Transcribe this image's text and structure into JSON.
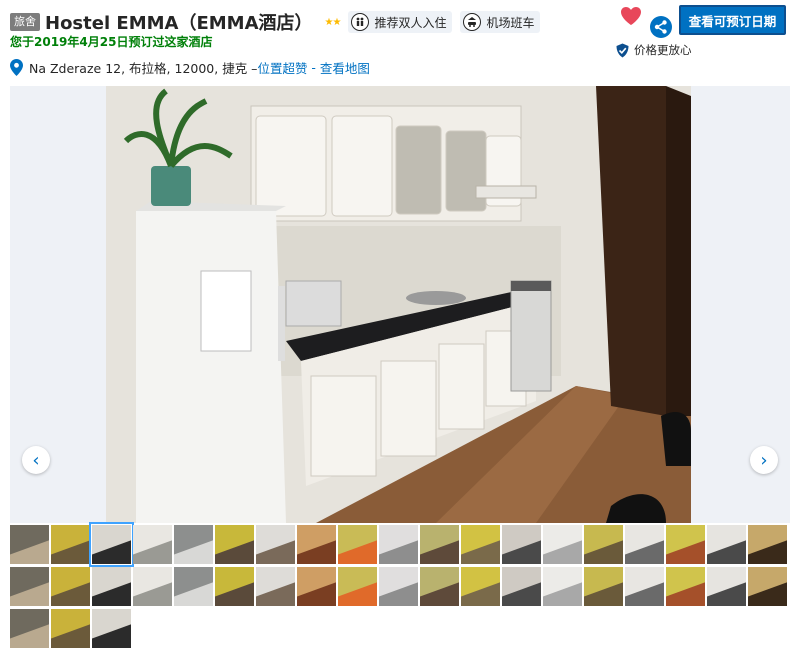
{
  "header": {
    "badge": "旅舍",
    "hotel_name": "Hostel EMMA（EMMA酒店）",
    "stars": "★★",
    "tags": [
      {
        "label": "推荐双人入住",
        "icon": "couple-icon"
      },
      {
        "label": "机场班车",
        "icon": "shuttle-icon"
      }
    ],
    "booked_note": "您于2019年4月25日预订过这家酒店",
    "address": "Na Zderaze 12, 布拉格, 12000, 捷克 – ",
    "location_link": "位置超赞",
    "separator": " - ",
    "map_link": "查看地图",
    "book_button": "查看可预订日期",
    "price_match": "价格更放心"
  },
  "gallery": {
    "prev_label": "‹",
    "next_label": "›",
    "thumbnail_count": 41,
    "active_thumbnail": 3
  },
  "colors": {
    "brand_blue": "#0071c2",
    "booked_green": "#008009",
    "heart_red": "#e8475a",
    "star_yellow": "#febb02"
  }
}
